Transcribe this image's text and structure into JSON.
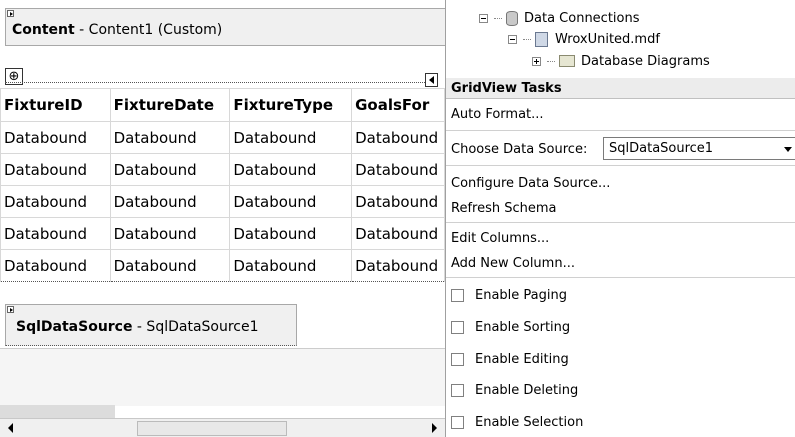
{
  "content_placeholder": {
    "bold": "Content",
    "rest": " - Content1 (Custom)"
  },
  "grid": {
    "move_glyph": "⊕",
    "columns": [
      "FixtureID",
      "FixtureDate",
      "FixtureType",
      "GoalsFor"
    ],
    "rows": [
      [
        "Databound",
        "Databound",
        "Databound",
        "Databound"
      ],
      [
        "Databound",
        "Databound",
        "Databound",
        "Databound"
      ],
      [
        "Databound",
        "Databound",
        "Databound",
        "Databound"
      ],
      [
        "Databound",
        "Databound",
        "Databound",
        "Databound"
      ],
      [
        "Databound",
        "Databound",
        "Databound",
        "Databound"
      ]
    ]
  },
  "sqldatasource": {
    "bold": "SqlDataSource",
    "rest": " - SqlDataSource1"
  },
  "tree": {
    "data_connections": "Data Connections",
    "database_file": "WroxUnited.mdf",
    "database_diagrams": "Database Diagrams"
  },
  "tasks": {
    "title": "GridView Tasks",
    "auto_format": "Auto Format...",
    "choose_data_source_label": "Choose Data Source:",
    "choose_data_source_value": "SqlDataSource1",
    "configure_data_source": "Configure Data Source...",
    "refresh_schema": "Refresh Schema",
    "edit_columns": "Edit Columns...",
    "add_new_column": "Add New Column...",
    "options": [
      {
        "label": "Enable Paging",
        "checked": false
      },
      {
        "label": "Enable Sorting",
        "checked": false
      },
      {
        "label": "Enable Editing",
        "checked": false
      },
      {
        "label": "Enable Deleting",
        "checked": false
      },
      {
        "label": "Enable Selection",
        "checked": false
      }
    ]
  }
}
